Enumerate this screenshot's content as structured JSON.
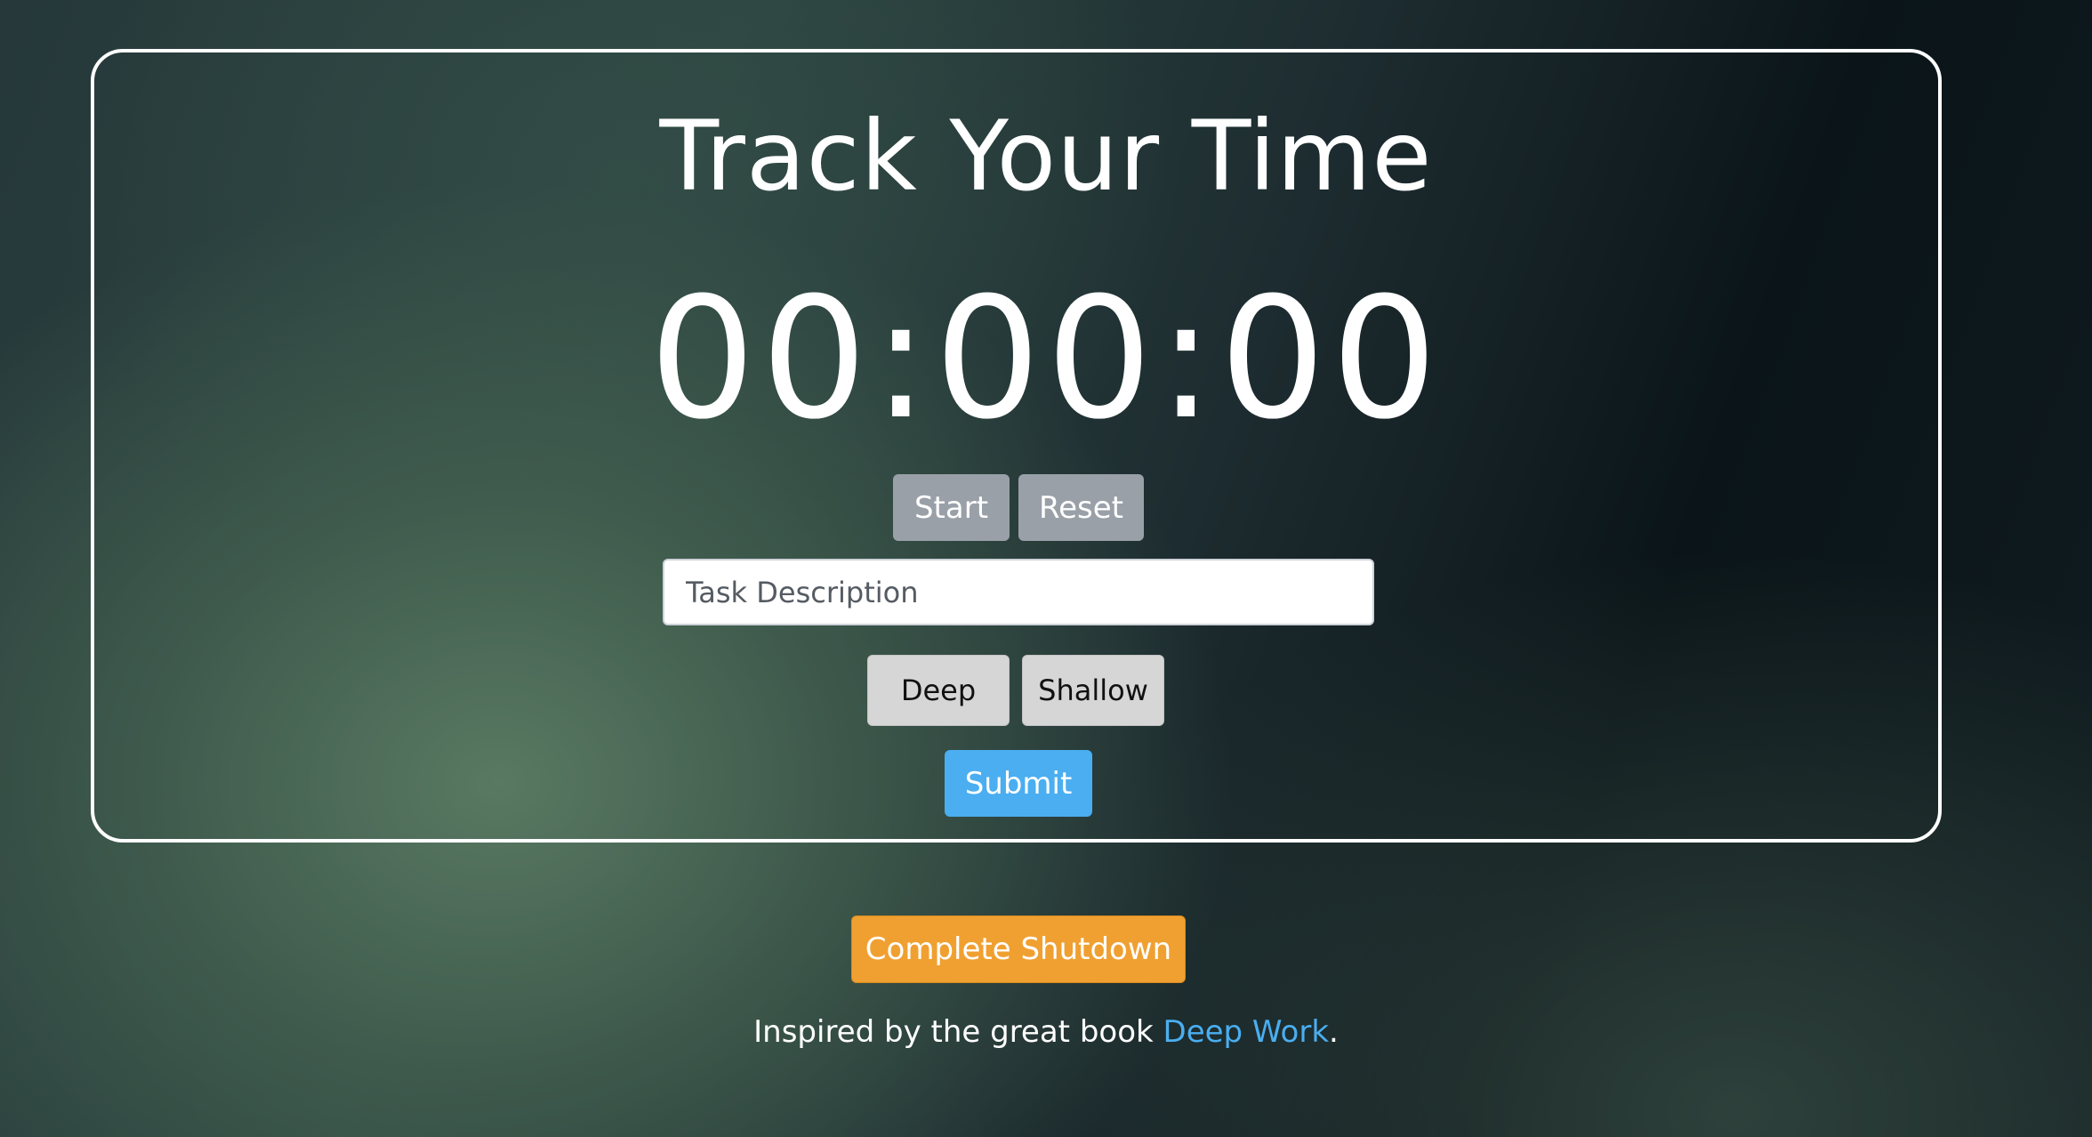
{
  "header": {
    "title": "Track Your Time"
  },
  "timer": {
    "display": "00:00:00"
  },
  "controls": {
    "start_label": "Start",
    "reset_label": "Reset"
  },
  "task": {
    "placeholder": "Task Description",
    "value": ""
  },
  "work_type": {
    "deep_label": "Deep",
    "shallow_label": "Shallow"
  },
  "submit_label": "Submit",
  "shutdown_label": "Complete Shutdown",
  "footer": {
    "text_before": "Inspired by the great book ",
    "link_text": "Deep Work",
    "text_after": "."
  },
  "colors": {
    "accent_blue": "#4aaef0",
    "shutdown_orange": "#f0a030",
    "gray_button": "#9aa0a8",
    "light_button": "#d6d6d6"
  }
}
